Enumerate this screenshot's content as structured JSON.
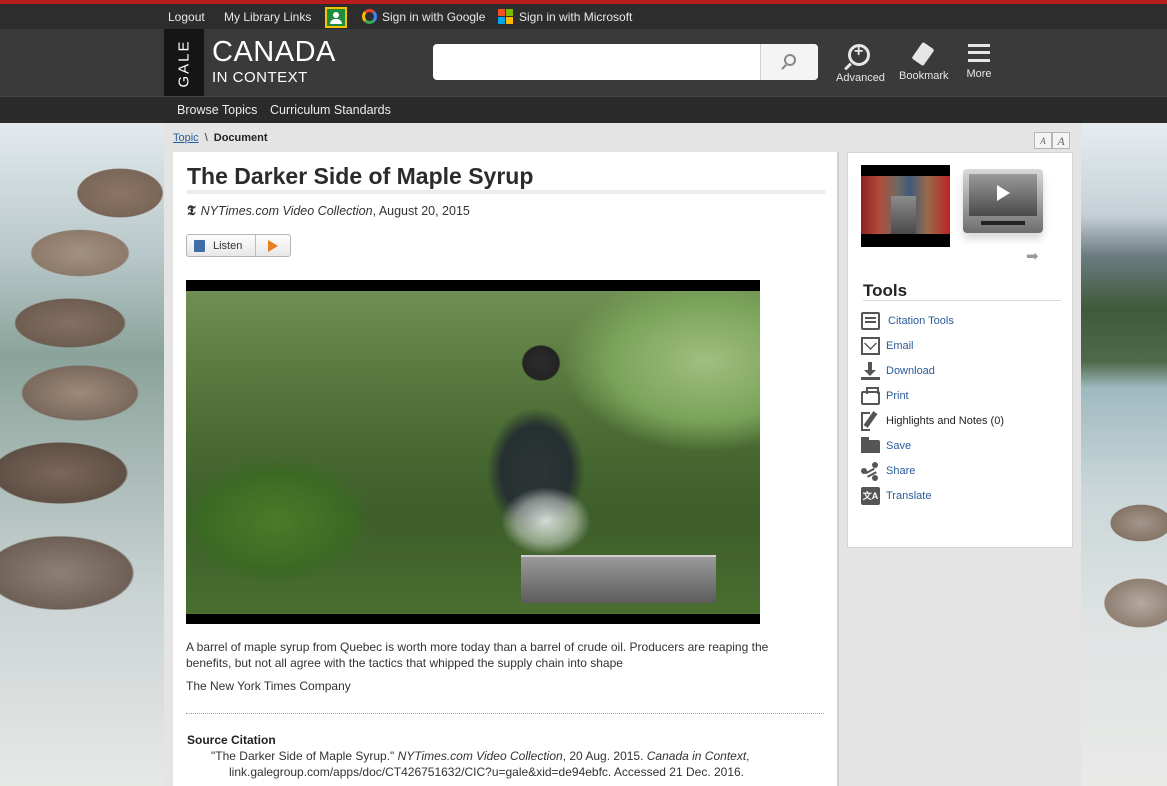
{
  "topbar": {
    "logout": "Logout",
    "library_links": "My Library Links",
    "google_signin": "Sign in with Google",
    "microsoft_signin": "Sign in with Microsoft"
  },
  "header": {
    "brand_short": "GALE",
    "product_line1": "CANADA",
    "product_line2": "IN CONTEXT",
    "search_placeholder": "",
    "advanced_label": "Advanced",
    "bookmark_label": "Bookmark",
    "more_label": "More"
  },
  "nav": {
    "browse_topics": "Browse Topics",
    "curriculum_standards": "Curriculum Standards"
  },
  "breadcrumb": {
    "topic": "Topic",
    "separator": "\\",
    "current": "Document"
  },
  "font_size_controls": [
    "A",
    "A"
  ],
  "document": {
    "title": "The Darker Side of Maple Syrup",
    "source_icon": "nyt-icon",
    "source": "NYTimes.com Video Collection",
    "date": ", August 20, 2015",
    "listen_label": "Listen",
    "summary": "A barrel of maple syrup from Quebec is worth more today than a barrel of crude oil. Producers are reaping the benefits, but not all agree with the tactics that whipped the supply chain into shape",
    "publisher": "The New York Times Company",
    "source_citation_heading": "Source Citation",
    "citation_part1": "\"The Darker Side of Maple Syrup.\" ",
    "citation_italic1": "NYTimes.com Video Collection",
    "citation_part2": ", 20 Aug. 2015. ",
    "citation_italic2": "Canada in Context",
    "citation_part3": ",",
    "citation_line2": "link.galegroup.com/apps/doc/CT426751632/CIC?u=gale&xid=de94ebfc. Accessed 21 Dec. 2016."
  },
  "sidebar": {
    "tools_heading": "Tools",
    "tools": [
      {
        "label": "Citation Tools",
        "icon": "citation-icon"
      },
      {
        "label": "Email",
        "icon": "email-icon"
      },
      {
        "label": "Download",
        "icon": "download-icon"
      },
      {
        "label": "Print",
        "icon": "print-icon"
      },
      {
        "label": "Highlights and Notes (0)",
        "icon": "highlight-icon"
      },
      {
        "label": "Save",
        "icon": "folder-icon"
      },
      {
        "label": "Share",
        "icon": "share-icon"
      },
      {
        "label": "Translate",
        "icon": "translate-icon"
      }
    ]
  },
  "colors": {
    "accent_red": "#b71c1c",
    "header_bg": "#3a3a3a",
    "link_blue": "#2a5a9a"
  }
}
